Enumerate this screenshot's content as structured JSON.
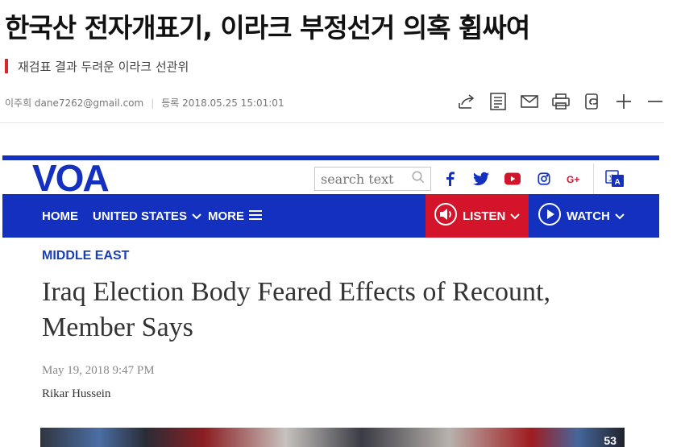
{
  "article": {
    "title": "한국산 전자개표기, 이라크 부정선거 의혹 휩싸여",
    "subtitle": "재검표 결과 두려운 이라크 선관위",
    "reporter": "이주희 dane7262@gmail.com",
    "registered": "등록 2018.05.25 15:01:01",
    "accent_color": "#d9262c"
  },
  "tools": [
    {
      "icon": "share-icon"
    },
    {
      "icon": "list-icon"
    },
    {
      "icon": "mail-icon"
    },
    {
      "icon": "print-icon"
    },
    {
      "icon": "copy-icon"
    },
    {
      "icon": "zoom-in-icon"
    },
    {
      "icon": "zoom-out-icon"
    }
  ],
  "voa": {
    "logo": "VOA",
    "search_placeholder": "search text",
    "social": [
      "facebook-icon",
      "twitter-icon",
      "youtube-icon",
      "instagram-icon",
      "google-plus-icon"
    ],
    "nav": {
      "home": "HOME",
      "united_states": "UNITED STATES",
      "more": "MORE",
      "listen": "LISTEN",
      "watch": "WATCH"
    },
    "section": "MIDDLE EAST",
    "headline": "Iraq Election Body Feared Effects of Recount, Member Says",
    "date": "May 19, 2018 9:47 PM",
    "author": "Rikar Hussein",
    "photo_badge": "53",
    "brand_blue": "#1330bf",
    "listen_red": "#d3142b"
  }
}
